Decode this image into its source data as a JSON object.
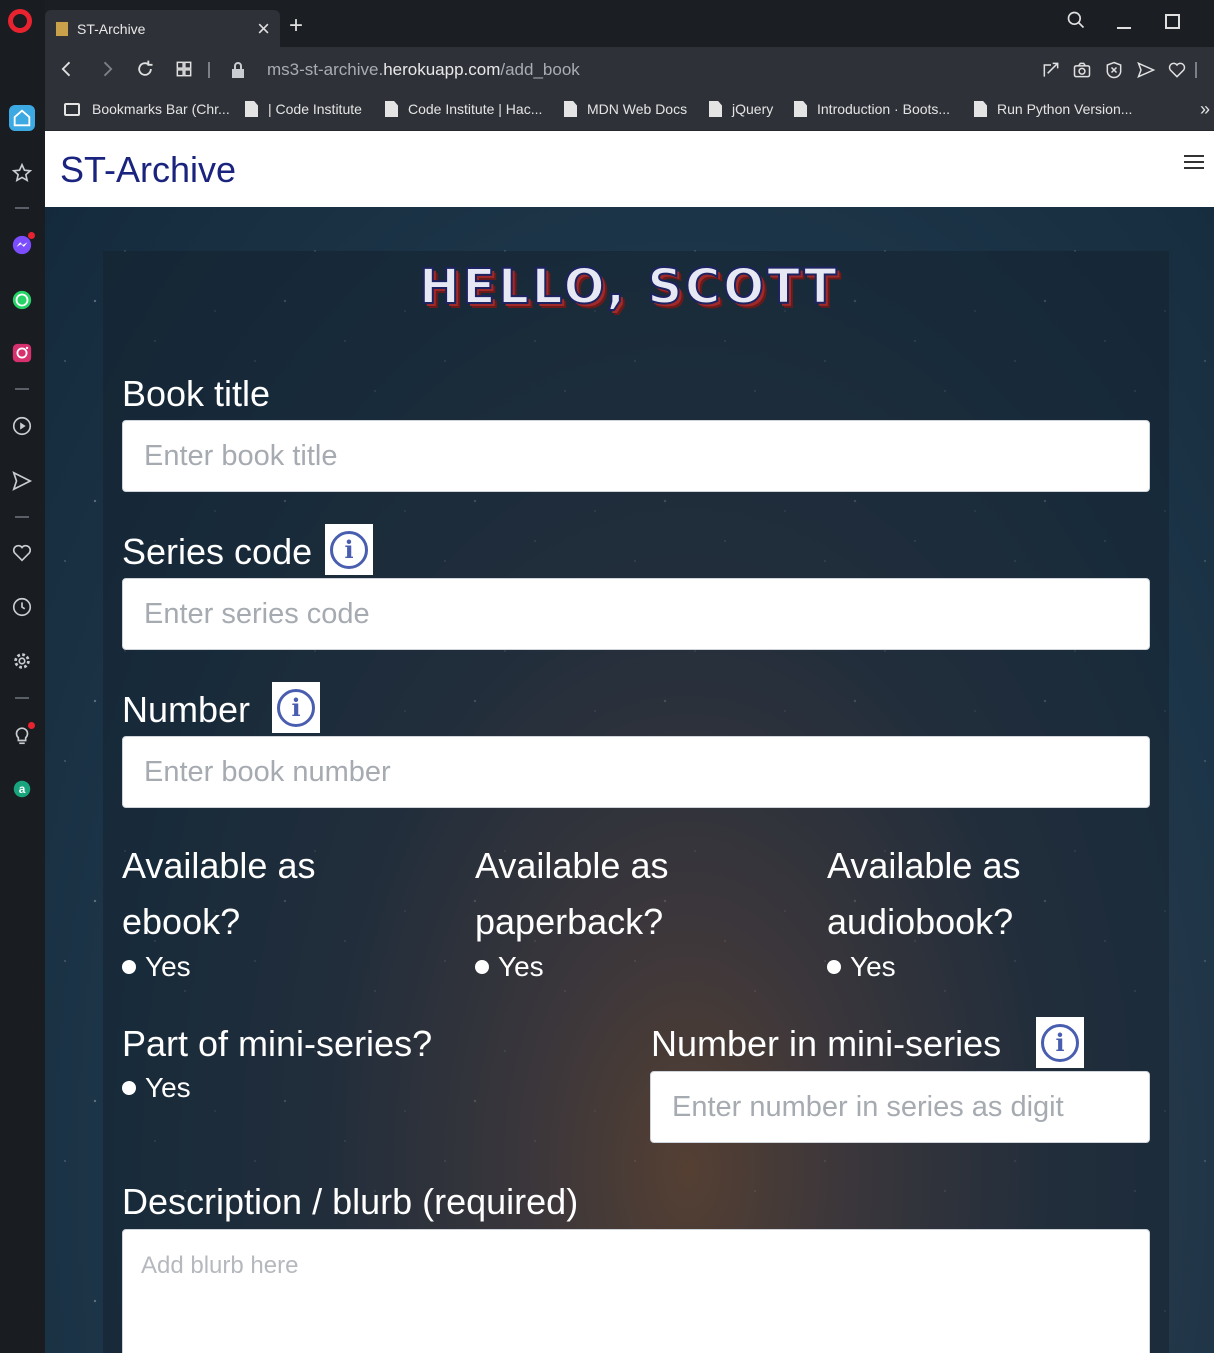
{
  "browser": {
    "tab_title": "ST-Archive",
    "url_prefix": "ms3-st-archive.",
    "url_host": "herokuapp.com",
    "url_path": "/add_book",
    "bookmarks": [
      "Bookmarks Bar (Chr...",
      "| Code Institute",
      "Code Institute | Hac...",
      "MDN Web Docs",
      "jQuery",
      "Introduction · Boots...",
      "Run Python Version..."
    ]
  },
  "navbar": {
    "brand": "ST-Archive"
  },
  "greeting": "HELLO, SCOTT",
  "form": {
    "book_title": {
      "label": "Book title",
      "placeholder": "Enter book title"
    },
    "series_code": {
      "label": "Series code",
      "placeholder": "Enter series code"
    },
    "number": {
      "label": "Number",
      "placeholder": "Enter book number"
    },
    "ebook": {
      "label_line1": "Available as",
      "label_line2": "ebook?",
      "option": "Yes"
    },
    "paperback": {
      "label_line1": "Available as",
      "label_line2": "paperback?",
      "option": "Yes"
    },
    "audiobook": {
      "label_line1": "Available as",
      "label_line2": "audiobook?",
      "option": "Yes"
    },
    "mini_series": {
      "label": "Part of mini-series?",
      "option": "Yes"
    },
    "mini_series_number": {
      "label": "Number in mini-series",
      "placeholder": "Enter number in series as digit"
    },
    "description": {
      "label": "Description / blurb (required)",
      "placeholder": "Add blurb here"
    }
  },
  "icons": {
    "info": "i"
  },
  "colors": {
    "brand": "#1a237e",
    "info_icon": "#4a5eb0",
    "opera_red": "#e8232f"
  }
}
